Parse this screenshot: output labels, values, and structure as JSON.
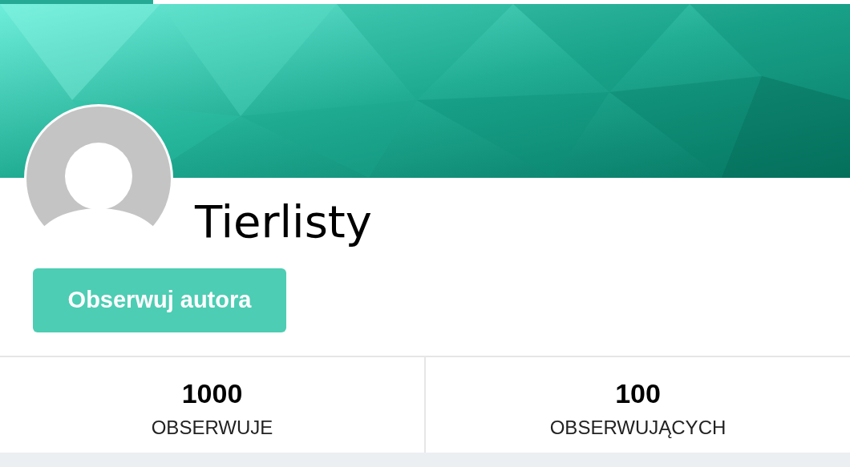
{
  "progress": {
    "level": 0.18
  },
  "profile": {
    "name": "Tierlisty",
    "follow_button": "Obserwuj autora"
  },
  "stats": [
    {
      "value": "1000",
      "label": "OBSERWUJE"
    },
    {
      "value": "100",
      "label": "OBSERWUJĄCYCH"
    }
  ]
}
